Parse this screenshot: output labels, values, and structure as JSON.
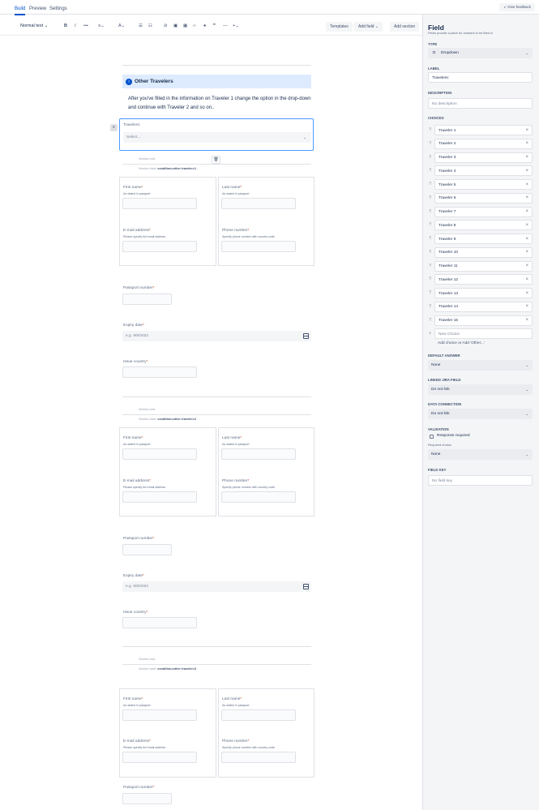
{
  "tabs": [
    "Build",
    "Preview",
    "Settings"
  ],
  "feedback_label": "Give feedback",
  "toolbar": {
    "text_style": "Normal text",
    "templates": "Templates",
    "add_field": "Add field",
    "add_section": "Add section"
  },
  "info_panel": {
    "icon": "i",
    "title": "Other Travelers"
  },
  "intro_text": "After you've filled in the information on Traveler 1 change the option in the drop-down and continue with Traveler 2 and so on..",
  "travelers_field": {
    "label": "Travelers:",
    "placeholder": "Select..."
  },
  "section_end_label": "Section end",
  "section_start_label": "Section start:",
  "sections": [
    {
      "condition": "condition=other traveler=1"
    },
    {
      "condition": "condition=other traveler=2"
    },
    {
      "condition": "condition=other traveler=3"
    }
  ],
  "traveler_form": {
    "first_name": "First name",
    "first_name_hint": "As stated in passport",
    "last_name": "Last name",
    "last_name_hint": "As stated in passport",
    "email": "E-mail address",
    "email_hint": "Please specify full email address",
    "phone": "Phone number",
    "phone_hint": "Specify phone number with country code",
    "passport": "Passport number",
    "expiry": "Expiry date",
    "expiry_placeholder": "e.g. 9/8/2022",
    "issue_country": "Issue country"
  },
  "sidebar": {
    "title": "Field",
    "subtitle": "Fields provide a place for answers to be filled in.",
    "type_label": "TYPE",
    "type_value": "Dropdown",
    "label_label": "LABEL",
    "label_value": "Travelers:",
    "description_label": "DESCRIPTION",
    "description_placeholder": "No description",
    "choices_label": "CHOICES",
    "choices": [
      "Traveler 1",
      "Traveler 2",
      "Traveler 3",
      "Traveler 4",
      "Traveler 5",
      "Traveler 6",
      "Traveler 7",
      "Traveler 8",
      "Traveler 9",
      "Traveler 10",
      "Traveler 11",
      "Traveler 12",
      "Traveler 13",
      "Traveler 14",
      "Traveler 15"
    ],
    "new_choice_placeholder": "New Choice",
    "add_choice_text": "Add choice or Add 'Other...'",
    "default_answer_label": "DEFAULT ANSWER",
    "default_answer_value": "None",
    "linked_jira_label": "LINKED JIRA FIELD",
    "linked_jira_value": "Do not link",
    "data_connection_label": "DATA CONNECTION",
    "data_connection_value": "Do not link",
    "validation_label": "VALIDATION",
    "response_required": "Response required",
    "required_choice_label": "Required choice",
    "required_choice_value": "None",
    "field_key_label": "FIELD KEY",
    "field_key_placeholder": "No field key"
  }
}
